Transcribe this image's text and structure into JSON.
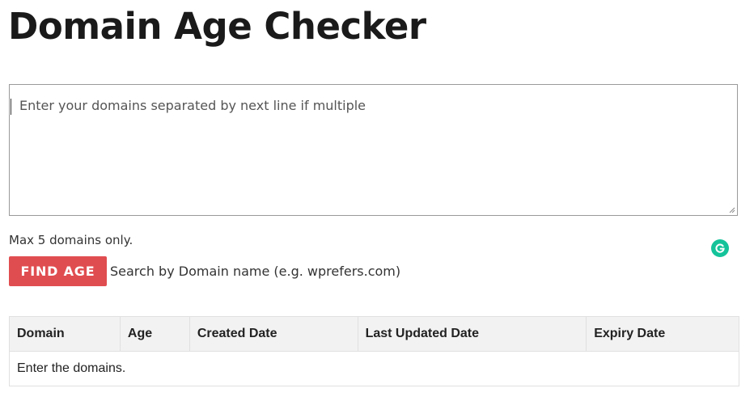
{
  "page": {
    "title": "Domain Age Checker"
  },
  "input": {
    "placeholder": "Enter your domains separated by next line if multiple",
    "value": ""
  },
  "note": "Max 5 domains only.",
  "actions": {
    "find_label": "FIND AGE",
    "hint": "Search by Domain name (e.g. wprefers.com)"
  },
  "table": {
    "headers": [
      "Domain",
      "Age",
      "Created Date",
      "Last Updated Date",
      "Expiry Date"
    ],
    "empty_message": "Enter the domains."
  },
  "colors": {
    "button": "#e04d50",
    "grammarly": "#15c39a"
  },
  "icons": {
    "grammarly": "grammarly-icon",
    "resize": "resize-grip-icon"
  }
}
